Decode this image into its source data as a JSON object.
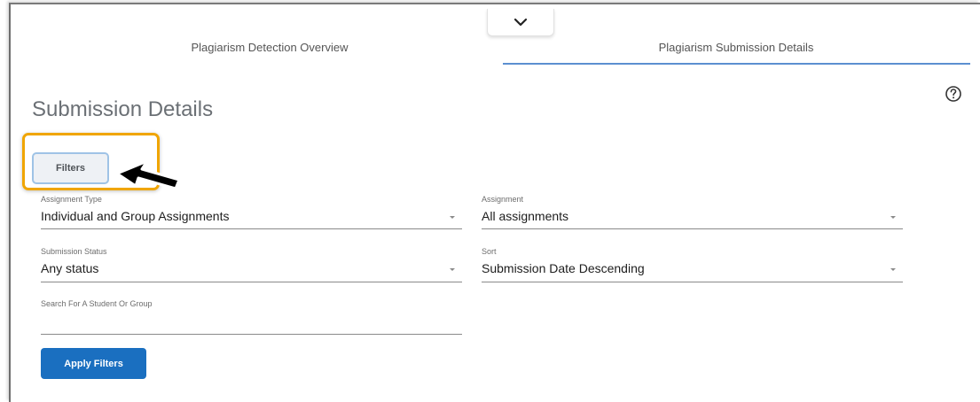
{
  "tabs": [
    {
      "label": "Plagiarism Detection Overview",
      "active": false
    },
    {
      "label": "Plagiarism Submission Details",
      "active": true
    }
  ],
  "icons": {
    "collapse": "chevron-down-icon",
    "help": "help-circle-icon",
    "cursor": "mouse-pointer-icon"
  },
  "page": {
    "title": "Submission Details"
  },
  "filters_button": {
    "label": "Filters"
  },
  "fields": {
    "assignment_type": {
      "label": "Assignment Type",
      "value": "Individual and Group Assignments"
    },
    "assignment": {
      "label": "Assignment",
      "value": "All assignments"
    },
    "submission_status": {
      "label": "Submission Status",
      "value": "Any status"
    },
    "sort": {
      "label": "Sort",
      "value": "Submission Date Descending"
    },
    "search": {
      "label": "Search For A Student Or Group",
      "value": ""
    }
  },
  "apply_button": {
    "label": "Apply Filters"
  },
  "colors": {
    "accent": "#1a6fc0",
    "tab_underline": "#5b8fd0",
    "highlight": "#f0a500"
  }
}
